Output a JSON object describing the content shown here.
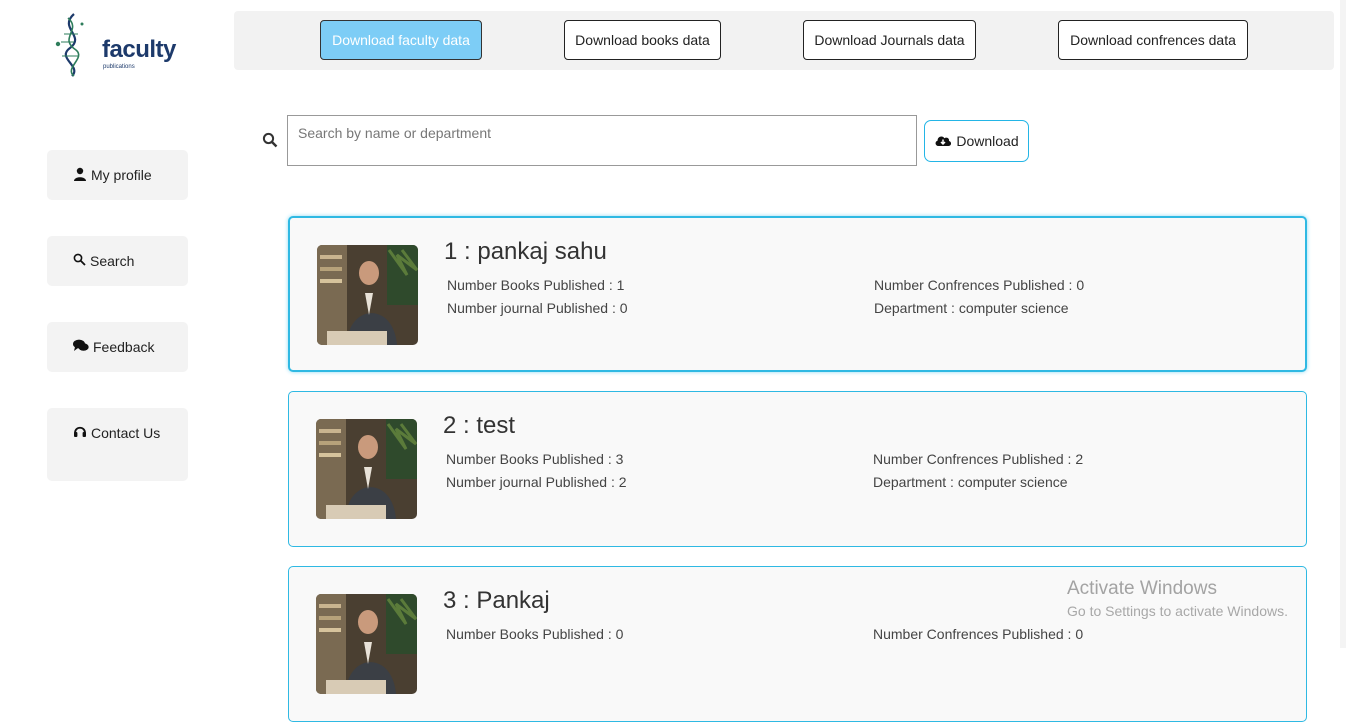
{
  "logo": {
    "name": "faculty",
    "subtitle": "publications"
  },
  "sidebar": {
    "items": [
      {
        "label": "My profile",
        "icon": "user-icon"
      },
      {
        "label": "Search",
        "icon": "magnifier-icon"
      },
      {
        "label": "Feedback",
        "icon": "comments-icon"
      },
      {
        "label": "Contact Us",
        "icon": "headset-icon"
      }
    ]
  },
  "topbar": {
    "buttons": [
      {
        "label": "Download faculty data",
        "active": true
      },
      {
        "label": "Download books data",
        "active": false
      },
      {
        "label": "Download Journals data",
        "active": false
      },
      {
        "label": "Download confrences data",
        "active": false
      }
    ]
  },
  "search": {
    "placeholder": "Search by name or department",
    "value": "",
    "download_label": "Download"
  },
  "colors": {
    "accent": "#2fb9e3",
    "active_button": "#7dcdf6",
    "logo": "#1d3a6b"
  },
  "faculty": [
    {
      "title": "1 : pankaj sahu",
      "books": "Number Books Published : 1",
      "journals": "Number journal Published : 0",
      "confrences": "Number Confrences Published : 0",
      "department": "Department : computer science"
    },
    {
      "title": "2 : test",
      "books": "Number Books Published : 3",
      "journals": "Number journal Published : 2",
      "confrences": "Number Confrences Published : 2",
      "department": "Department : computer science"
    },
    {
      "title": "3 : Pankaj",
      "books": "Number Books Published : 0",
      "journals": "",
      "confrences": "Number Confrences Published : 0",
      "department": ""
    }
  ],
  "watermark": {
    "line1": "Activate Windows",
    "line2": "Go to Settings to activate Windows."
  }
}
